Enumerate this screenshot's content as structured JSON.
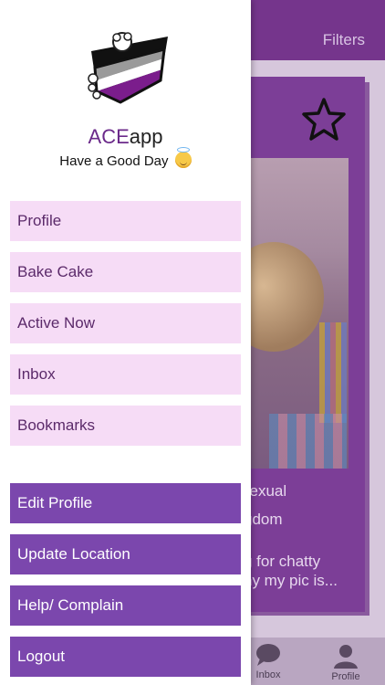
{
  "background": {
    "header": {
      "filters_label": "Filters"
    },
    "card": {
      "line1": "sexual",
      "line2": "gdom",
      "line3": "g for chatty",
      "line4": "hy my pic is..."
    },
    "tabbar": {
      "inbox_label": "Inbox",
      "profile_label": "Profile"
    }
  },
  "drawer": {
    "app_name_prefix": "ACE",
    "app_name_suffix": "app",
    "greeting": "Have a Good Day",
    "menu_top": [
      {
        "label": "Profile"
      },
      {
        "label": "Bake Cake"
      },
      {
        "label": "Active Now"
      },
      {
        "label": "Inbox"
      },
      {
        "label": "Bookmarks"
      }
    ],
    "menu_bottom": [
      {
        "label": "Edit Profile"
      },
      {
        "label": "Update Location"
      },
      {
        "label": "Help/ Complain"
      },
      {
        "label": "Logout"
      }
    ]
  },
  "colors": {
    "purple": "#75358c",
    "menu_light": "#f6dcf6",
    "menu_dark": "#7b47ad"
  }
}
